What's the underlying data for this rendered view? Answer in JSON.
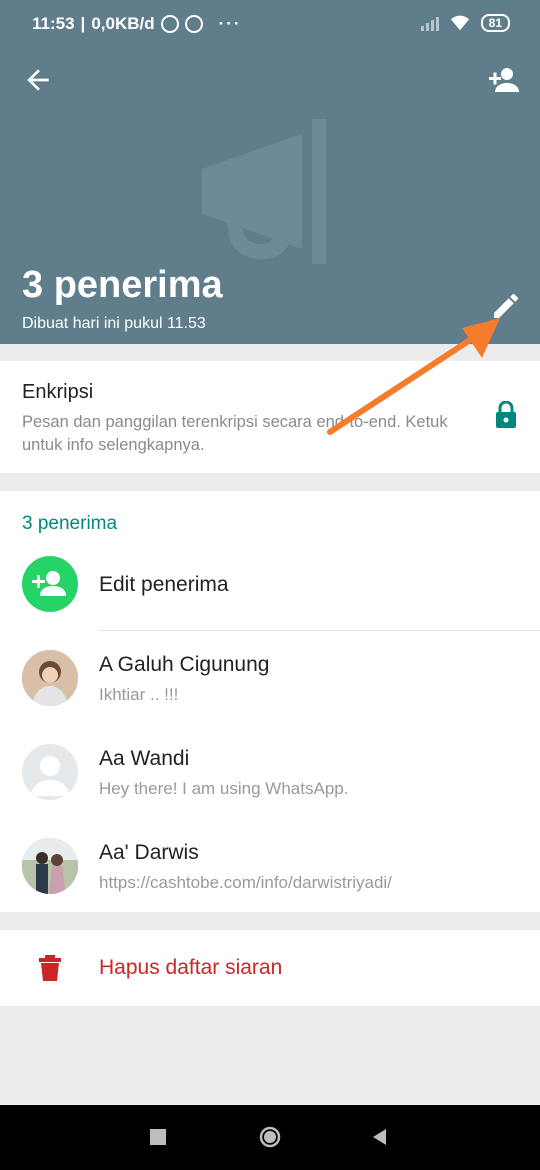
{
  "status_bar": {
    "time": "11:53",
    "network_speed": "0,0KB/d",
    "battery": "81"
  },
  "header": {
    "title": "3 penerima",
    "subtitle": "Dibuat hari ini pukul 11.53",
    "background_color": "#607d8b"
  },
  "encryption": {
    "title": "Enkripsi",
    "description": "Pesan dan panggilan terenkripsi secara end-to-end. Ketuk untuk info selengkapnya."
  },
  "recipients": {
    "section_title": "3 penerima",
    "edit_label": "Edit penerima",
    "contacts": [
      {
        "name": "A Galuh Cigunung",
        "status": "Ikhtiar .. !!!"
      },
      {
        "name": "Aa Wandi",
        "status": "Hey there! I am using WhatsApp."
      },
      {
        "name": "Aa' Darwis",
        "status": "https://cashtobe.com/info/darwistriyadi/"
      }
    ]
  },
  "delete": {
    "label": "Hapus daftar siaran"
  },
  "colors": {
    "accent_green": "#25d366",
    "teal": "#00897b",
    "danger": "#c62828",
    "arrow": "#f47c2c"
  }
}
